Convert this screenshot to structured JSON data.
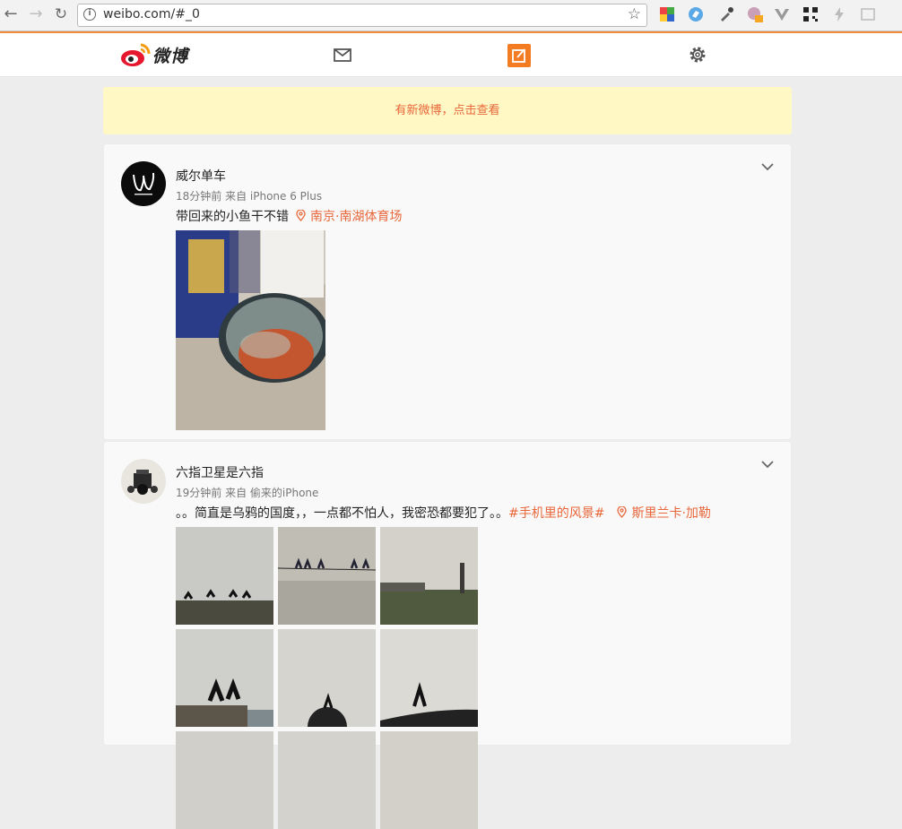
{
  "browser": {
    "url": "weibo.com/#_0"
  },
  "topnav": {
    "logo_text": "微博"
  },
  "banner": {
    "text": "有新微博，点击查看"
  },
  "posts": [
    {
      "username": "威尔单车",
      "meta": "18分钟前 来自 iPhone 6 Plus",
      "text": "带回来的小鱼干不错",
      "location": "南京·南湖体育场"
    },
    {
      "username": "六指卫星是六指",
      "meta": "19分钟前 来自 偷来的iPhone",
      "text": "。。简直是乌鸦的国度，，一点都不怕人，我密恐都要犯了。。",
      "hashtag": "#手机里的风景#",
      "location": "斯里兰卡·加勒"
    }
  ],
  "colors": {
    "accent": "#e8663a",
    "banner_bg": "#fff8c4",
    "compose_orange": "#f37b22"
  }
}
